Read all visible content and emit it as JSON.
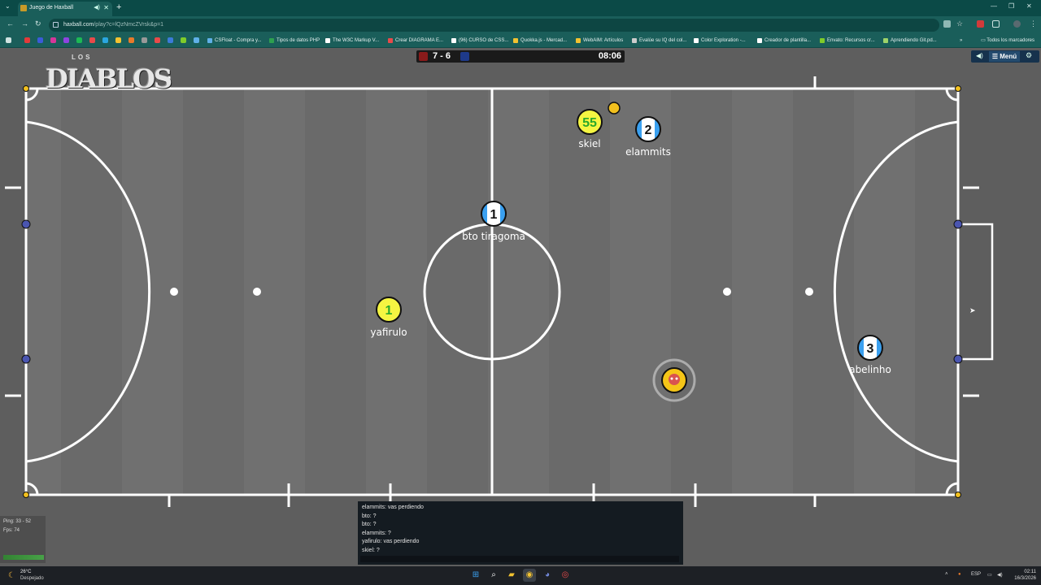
{
  "browser": {
    "tab_title": "Juego de Haxball",
    "tab_mute_icon": "speaker-icon",
    "url_host": "haxball.com",
    "url_path": "/play?c=lQzNmcZVrsk&p=1",
    "all_bookmarks": "Todos los marcadores",
    "bookmarks": [
      {
        "label": "CSFloat - Compra y...",
        "color": "#5fb0e8"
      },
      {
        "label": "Tipos de datos PHP",
        "color": "#2ea04f"
      },
      {
        "label": "The W3C Markup V...",
        "color": "#ffffff"
      },
      {
        "label": "Crear DIAGRAMA E...",
        "color": "#e84a4a"
      },
      {
        "label": "(96) CURSO de CSS...",
        "color": "#ffffff"
      },
      {
        "label": "Quokka.js - Mercad...",
        "color": "#f2c230"
      },
      {
        "label": "WebAIM: Artículos",
        "color": "#f2c230"
      },
      {
        "label": "Evalúe su IQ del col...",
        "color": "#cccccc"
      },
      {
        "label": "Color Exploration -...",
        "color": "#ffffff"
      },
      {
        "label": "Creador de plantilla...",
        "color": "#ffffff"
      },
      {
        "label": "Envato: Recursos cr...",
        "color": "#7fcc2a"
      },
      {
        "label": "Aprendiendo Git.pd...",
        "color": "#9ed36a"
      }
    ]
  },
  "game": {
    "score": "7 - 6",
    "clock": "08:06",
    "red_color": "#8a1b1b",
    "blue_color": "#1e3a8a",
    "menu_label": "Menú",
    "logo_top": "LOS",
    "logo_main": "DIABLOS",
    "players": [
      {
        "name": "skiel",
        "number": "55",
        "team": "yellow"
      },
      {
        "name": "elammits",
        "number": "2",
        "team": "blue"
      },
      {
        "name": "bto tiragoma",
        "number": "1",
        "team": "blue"
      },
      {
        "name": "yafirulo",
        "number": "1",
        "team": "yellow"
      },
      {
        "name": "abelinho",
        "number": "3",
        "team": "blue"
      }
    ],
    "ping_label": "Ping: 33 - 52",
    "fps_label": "Fps: 74"
  },
  "chat": {
    "messages": [
      "elammits: vas perdiendo",
      "bto: ?",
      "bto: ?",
      "elammits: ?",
      "yafirulo: vas perdiendo",
      "skiel: ?"
    ]
  },
  "taskbar": {
    "temperature": "26°C",
    "weather": "Despejado",
    "lang": "ESP",
    "time": "02:11",
    "date": "16/3/2026"
  }
}
